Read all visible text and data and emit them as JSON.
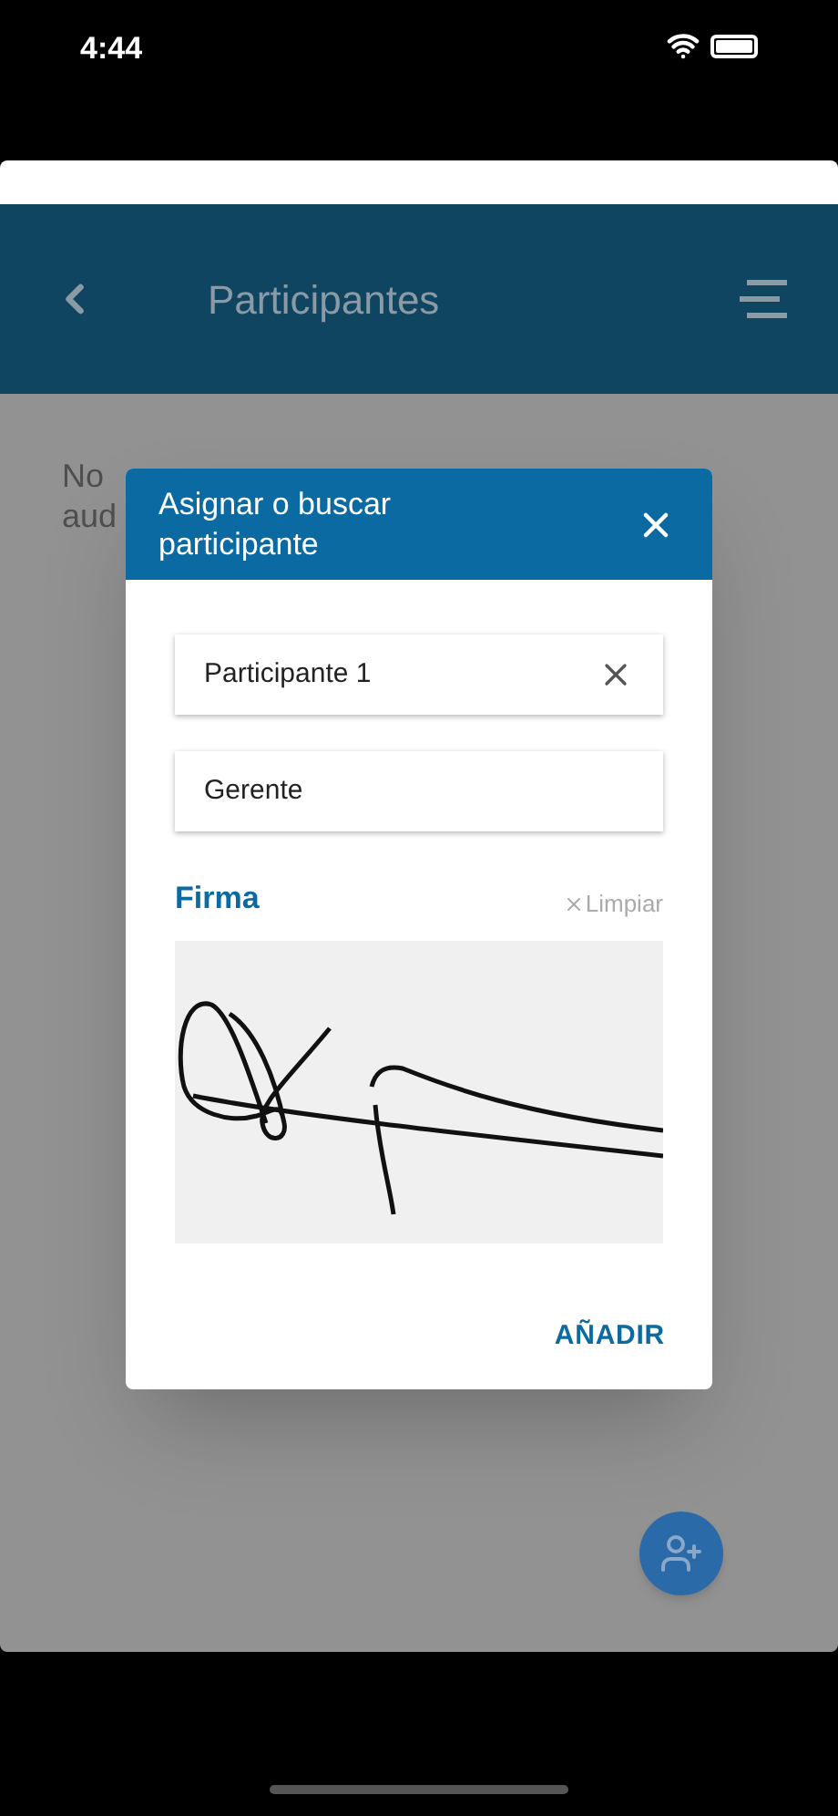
{
  "status_bar": {
    "time": "4:44"
  },
  "header": {
    "title": "Participantes"
  },
  "background_text": [
    "No",
    "aud"
  ],
  "dialog": {
    "title": "Asignar o buscar participante",
    "fields": [
      {
        "value": "Participante 1",
        "clearable": true
      },
      {
        "value": "Gerente",
        "clearable": false
      }
    ],
    "signature": {
      "label": "Firma",
      "clear_label": "Limpiar"
    },
    "action": "AÑADIR"
  }
}
